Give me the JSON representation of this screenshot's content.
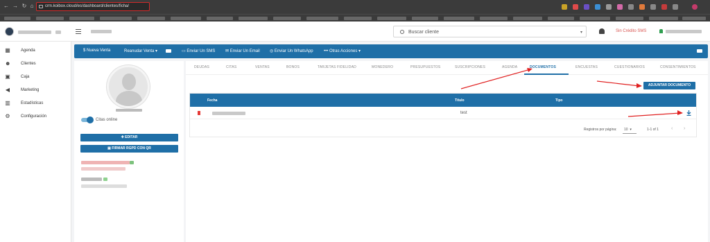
{
  "browser": {
    "url": "crm.koibox.cloud/es/dashboard/clientes/ficha/",
    "nav_icons": [
      "back-icon",
      "forward-icon",
      "reload-icon",
      "home-icon"
    ]
  },
  "header": {
    "search_placeholder": "Buscar cliente",
    "sms_status": "Sin Crédito SMS"
  },
  "sidebar": {
    "items": [
      {
        "label": "Agenda",
        "icon": "calendar-icon"
      },
      {
        "label": "Clientes",
        "icon": "clients-icon"
      },
      {
        "label": "Caja",
        "icon": "cash-icon"
      },
      {
        "label": "Marketing",
        "icon": "megaphone-icon"
      },
      {
        "label": "Estadísticas",
        "icon": "chart-icon"
      },
      {
        "label": "Configuración",
        "icon": "gear-icon"
      }
    ]
  },
  "actions": {
    "nueva_venta": "Nueva Venta",
    "reanudar_venta": "Reanudar Venta",
    "enviar_sms": "Enviar Un SMS",
    "enviar_email": "Enviar Un Email",
    "enviar_whatsapp": "Enviar Un WhatsApp",
    "otras_acciones": "Otras Acciones"
  },
  "profile": {
    "citas_online": "Citas online",
    "editar": "EDITAR",
    "firmar": "FIRMAR RGPD CON QR"
  },
  "tabs": [
    "DEUDAS",
    "CITAS",
    "VENTAS",
    "BONOS",
    "TARJETAS FIDELIDAD",
    "MONEDERO",
    "PRESUPUESTOS",
    "SUSCRIPCIONES",
    "AGENDA",
    "DOCUMENTOS",
    "ENCUESTAS",
    "CUESTIONARIOS",
    "CONSENTIMIENTOS"
  ],
  "active_tab": "DOCUMENTOS",
  "documents": {
    "attach_button": "ADJUNTAR DOCUMENTO",
    "columns": {
      "fecha": "Fecha",
      "titulo": "Título",
      "tipo": "Tipo"
    },
    "rows": [
      {
        "fecha": "",
        "titulo": "test",
        "tipo": ""
      }
    ],
    "per_page_label": "Registros por página:",
    "per_page_value": "10",
    "range": "1-1 of 1"
  },
  "colors": {
    "primary": "#1f6fa7",
    "danger": "#e53935",
    "annotation": "#e02020"
  }
}
